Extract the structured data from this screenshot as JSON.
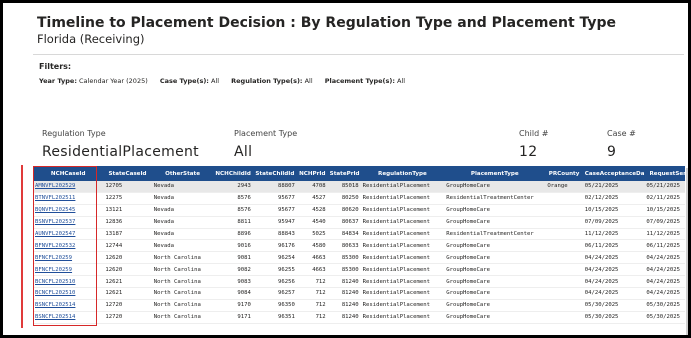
{
  "report": {
    "title": "Timeline to Placement Decision : By Regulation Type and Placement Type",
    "subtitle": "Florida (Receiving)"
  },
  "filters": {
    "heading": "Filters:",
    "year_label": "Year Type:",
    "year_value": "Calendar Year (2025)",
    "case_label": "Case Type(s):",
    "case_value": "All",
    "reg_label": "Regulation Type(s):",
    "reg_value": "All",
    "place_label": "Placement Type(s):",
    "place_value": "All"
  },
  "cards": {
    "regulation_label": "Regulation Type",
    "regulation_value": "ResidentialPlacement",
    "placement_label": "Placement Type",
    "placement_value": "All",
    "child_label": "Child #",
    "child_value": "12",
    "case_label": "Case #",
    "case_value": "9"
  },
  "table": {
    "columns": [
      "NCHCaseId",
      "StateCaseId",
      "OtherState",
      "NCHChildId",
      "StateChildId",
      "NCHPrId",
      "StatePrId",
      "RegulationType",
      "PlacementType",
      "PRCounty",
      "CaseAcceptanceDate",
      "RequestSent"
    ],
    "rows": [
      [
        "AMNVFL202529",
        "12705",
        "Nevada",
        "2943",
        "88807",
        "4708",
        "85018",
        "ResidentialPlacement",
        "GroupHomeCare",
        "Orange",
        "05/21/2025",
        "05/21/2025"
      ],
      [
        "BTNVFL202511",
        "12275",
        "Nevada",
        "8576",
        "95677",
        "4527",
        "80250",
        "ResidentialPlacement",
        "ResidentialTreatmentCenter",
        "",
        "02/12/2025",
        "02/11/2025"
      ],
      [
        "BQNVFL202545",
        "13121",
        "Nevada",
        "8576",
        "95677",
        "4528",
        "80620",
        "ResidentialPlacement",
        "GroupHomeCare",
        "",
        "10/15/2025",
        "10/15/2025"
      ],
      [
        "BSNVFL202537",
        "12836",
        "Nevada",
        "8811",
        "95947",
        "4540",
        "80637",
        "ResidentialPlacement",
        "GroupHomeCare",
        "",
        "07/09/2025",
        "07/09/2025"
      ],
      [
        "AUNVFL202547",
        "13187",
        "Nevada",
        "8896",
        "88843",
        "5025",
        "84834",
        "ResidentialPlacement",
        "ResidentialTreatmentCenter",
        "",
        "11/12/2025",
        "11/12/2025"
      ],
      [
        "BFNVFL202532",
        "12744",
        "Nevada",
        "9016",
        "96176",
        "4580",
        "80633",
        "ResidentialPlacement",
        "GroupHomeCare",
        "",
        "06/11/2025",
        "06/11/2025"
      ],
      [
        "BFNCFL20259",
        "12620",
        "North Carolina",
        "9081",
        "96254",
        "4663",
        "85300",
        "ResidentialPlacement",
        "GroupHomeCare",
        "",
        "04/24/2025",
        "04/24/2025"
      ],
      [
        "BFNCFL20259",
        "12620",
        "North Carolina",
        "9082",
        "96255",
        "4663",
        "85300",
        "ResidentialPlacement",
        "GroupHomeCare",
        "",
        "04/24/2025",
        "04/24/2025"
      ],
      [
        "BCNCFL202510",
        "12621",
        "North Carolina",
        "9083",
        "96256",
        "712",
        "81240",
        "ResidentialPlacement",
        "GroupHomeCare",
        "",
        "04/24/2025",
        "04/24/2025"
      ],
      [
        "BCNCFL202510",
        "12621",
        "North Carolina",
        "9084",
        "96257",
        "712",
        "81240",
        "ResidentialPlacement",
        "GroupHomeCare",
        "",
        "04/24/2025",
        "04/24/2025"
      ],
      [
        "BSNCFL202514",
        "12720",
        "North Carolina",
        "9170",
        "96350",
        "712",
        "81240",
        "ResidentialPlacement",
        "GroupHomeCare",
        "",
        "05/30/2025",
        "05/30/2025"
      ],
      [
        "BSNCFL202514",
        "12720",
        "North Carolina",
        "9171",
        "96351",
        "712",
        "81240",
        "ResidentialPlacement",
        "GroupHomeCare",
        "",
        "05/30/2025",
        "05/30/2025"
      ]
    ],
    "selected_row": 0
  }
}
